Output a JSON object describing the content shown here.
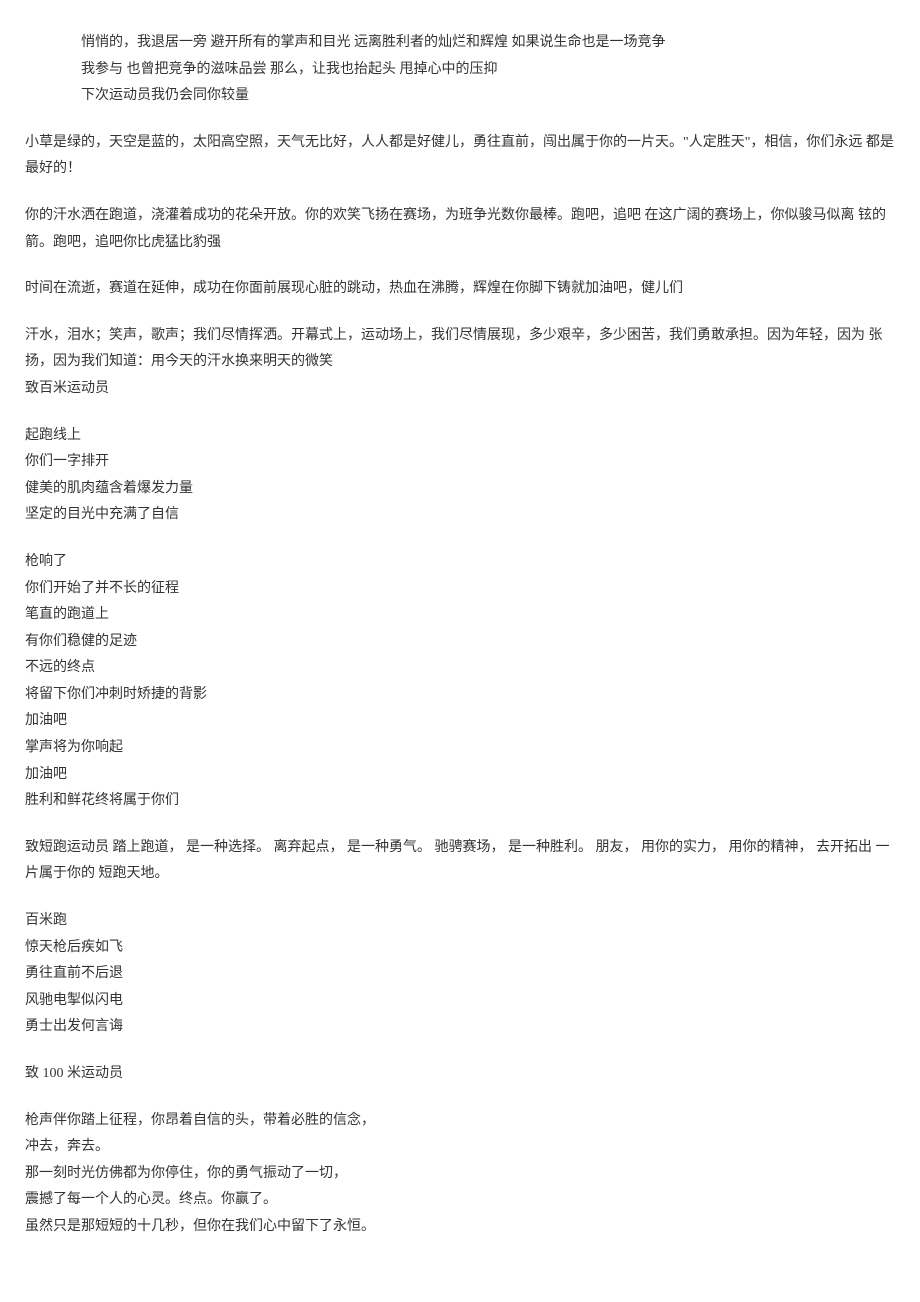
{
  "block1": {
    "l1": "悄悄的，我退居一旁 避开所有的掌声和目光 远离胜利者的灿烂和辉煌 如果说生命也是一场竞争",
    "l2": "我参与 也曾把竞争的滋味品尝 那么，让我也抬起头 甩掉心中的压抑",
    "l3": "下次运动员我仍会同你较量"
  },
  "p1": "小草是绿的，天空是蓝的，太阳高空照，天气无比好，人人都是好健儿，勇往直前，闯出属于你的一片天。\"人定胜天\"，相信，你们永远 都是最好的！",
  "p2": "你的汗水洒在跑道，浇灌着成功的花朵开放。你的欢笑飞扬在赛场，为班争光数你最棒。跑吧，追吧 在这广阔的赛场上，你似骏马似离 铉的箭。跑吧，追吧你比虎猛比豹强",
  "p3": "时间在流逝，赛道在延伸，成功在你面前展现心脏的跳动，热血在沸腾，辉煌在你脚下铸就加油吧，健儿们",
  "p4a": "汗水，泪水；笑声，歌声；我们尽情挥洒。开幕式上，运动场上，我们尽情展现，多少艰辛，多少困苦，我们勇敢承担。因为年轻，因为 张扬，因为我们知道：用今天的汗水换来明天的微笑",
  "p4b": "致百米运动员",
  "stanza1": {
    "l1": "起跑线上",
    "l2": "你们一字排开",
    "l3": "健美的肌肉蕴含着爆发力量",
    "l4": "坚定的目光中充满了自信"
  },
  "stanza2": {
    "l1": "枪响了",
    "l2": "你们开始了并不长的征程",
    "l3": "笔直的跑道上",
    "l4": "有你们稳健的足迹",
    "l5": "不远的终点",
    "l6": "将留下你们冲刺时矫捷的背影",
    "l7": "加油吧",
    "l8": "掌声将为你响起",
    "l9": "加油吧",
    "l10": "胜利和鲜花终将属于你们"
  },
  "p5": "致短跑运动员 踏上跑道， 是一种选择。 离弃起点， 是一种勇气。 驰骋赛场， 是一种胜利。 朋友， 用你的实力， 用你的精神， 去开拓出 一片属于你的 短跑天地。",
  "stanza3": {
    "l1": "百米跑",
    "l2": "惊天枪后疾如飞",
    "l3": "勇往直前不后退",
    "l4": "风驰电掣似闪电",
    "l5": "勇士出发何言诲"
  },
  "p6": "致 100 米运动员",
  "stanza4": {
    "l1": "枪声伴你踏上征程，你昂着自信的头，带着必胜的信念，",
    "l2": "冲去，奔去。",
    "l3": "那一刻时光仿佛都为你停住，你的勇气振动了一切，",
    "l4": "震撼了每一个人的心灵。终点。你赢了。",
    "l5": "虽然只是那短短的十几秒，但你在我们心中留下了永恒。"
  }
}
